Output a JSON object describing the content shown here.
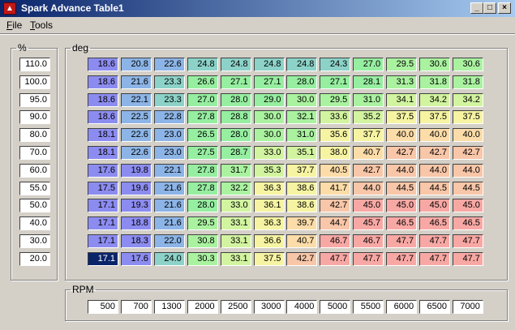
{
  "window": {
    "title": "Spark Advance Table1",
    "icon": "app-logo-icon",
    "controls": [
      "minimize",
      "maximize",
      "close"
    ]
  },
  "menu": [
    {
      "accel": "F",
      "rest": "ile"
    },
    {
      "accel": "T",
      "rest": "ools"
    }
  ],
  "load_axis": {
    "label": "%",
    "values": [
      "110.0",
      "100.0",
      "95.0",
      "90.0",
      "80.0",
      "70.0",
      "60.0",
      "55.0",
      "50.0",
      "40.0",
      "30.0",
      "20.0"
    ]
  },
  "table": {
    "label": "deg",
    "selected": {
      "row": 11,
      "col": 0
    },
    "rows": [
      [
        "18.6",
        "20.8",
        "22.6",
        "24.8",
        "24.8",
        "24.8",
        "24.8",
        "24.3",
        "27.0",
        "29.5",
        "30.6",
        "30.6"
      ],
      [
        "18.6",
        "21.6",
        "23.3",
        "26.6",
        "27.1",
        "27.1",
        "28.0",
        "27.1",
        "28.1",
        "31.3",
        "31.8",
        "31.8"
      ],
      [
        "18.6",
        "22.1",
        "23.3",
        "27.0",
        "28.0",
        "29.0",
        "30.0",
        "29.5",
        "31.0",
        "34.1",
        "34.2",
        "34.2"
      ],
      [
        "18.6",
        "22.5",
        "22.8",
        "27.8",
        "28.8",
        "30.0",
        "32.1",
        "33.6",
        "35.2",
        "37.5",
        "37.5",
        "37.5"
      ],
      [
        "18.1",
        "22.6",
        "23.0",
        "26.5",
        "28.0",
        "30.0",
        "31.0",
        "35.6",
        "37.7",
        "40.0",
        "40.0",
        "40.0"
      ],
      [
        "18.1",
        "22.6",
        "23.0",
        "27.5",
        "28.7",
        "33.0",
        "35.1",
        "38.0",
        "40.7",
        "42.7",
        "42.7",
        "42.7"
      ],
      [
        "17.6",
        "19.8",
        "22.1",
        "27.8",
        "31.7",
        "35.3",
        "37.7",
        "40.5",
        "42.7",
        "44.0",
        "44.0",
        "44.0"
      ],
      [
        "17.5",
        "19.6",
        "21.6",
        "27.8",
        "32.2",
        "36.3",
        "38.6",
        "41.7",
        "44.0",
        "44.5",
        "44.5",
        "44.5"
      ],
      [
        "17.1",
        "19.3",
        "21.6",
        "28.0",
        "33.0",
        "36.1",
        "38.6",
        "42.7",
        "45.0",
        "45.0",
        "45.0",
        "45.0"
      ],
      [
        "17.1",
        "18.8",
        "21.6",
        "29.5",
        "33.1",
        "36.3",
        "39.7",
        "44.7",
        "45.7",
        "46.5",
        "46.5",
        "46.5"
      ],
      [
        "17.1",
        "18.3",
        "22.0",
        "30.8",
        "33.1",
        "36.6",
        "40.7",
        "46.7",
        "46.7",
        "47.7",
        "47.7",
        "47.7"
      ],
      [
        "17.1",
        "17.6",
        "24.0",
        "30.3",
        "33.1",
        "37.5",
        "42.7",
        "47.7",
        "47.7",
        "47.7",
        "47.7",
        "47.7"
      ]
    ],
    "palette": [
      "#8c8cf0",
      "#8cb4e6",
      "#8cd2c8",
      "#96eea0",
      "#aaf2a0",
      "#d2f4a0",
      "#f6f4a2",
      "#fcdca8",
      "#f8c6a8",
      "#f8a8a4",
      "#f49898"
    ]
  },
  "rpm_axis": {
    "label": "RPM",
    "values": [
      "500",
      "700",
      "1300",
      "2000",
      "2500",
      "3000",
      "4000",
      "5000",
      "5500",
      "6000",
      "6500",
      "7000"
    ]
  }
}
